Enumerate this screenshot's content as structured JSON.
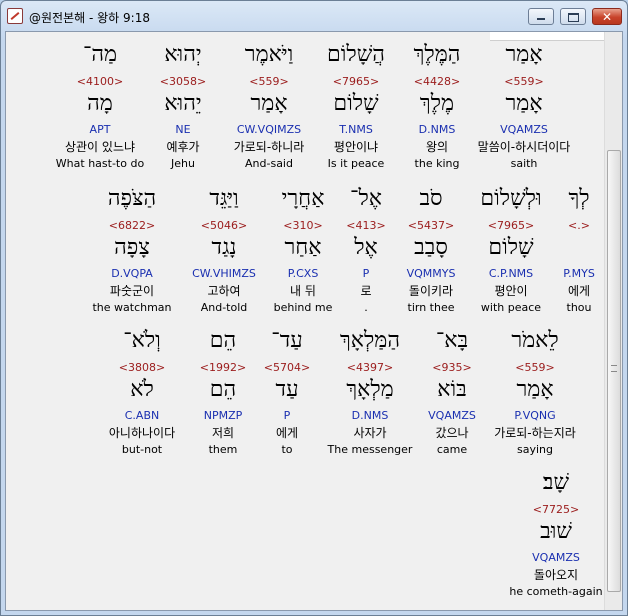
{
  "window": {
    "title": "@원전본해 - 왕하 9:18",
    "buttons": {
      "minimize": "minimize",
      "maximize": "maximize",
      "close": "✕"
    }
  },
  "rows": [
    {
      "words": [
        {
          "heb": "אָמַר",
          "strong": "<559>",
          "lemma": "אָמַר",
          "morph": "VQAMZS",
          "ko": "말씀이-하시더이다",
          "en": "saith"
        },
        {
          "heb": "הַמֶּלֶךְ",
          "strong": "<4428>",
          "lemma": "מֶלֶךְ",
          "morph": "D.NMS",
          "ko": "왕의",
          "en": "the king"
        },
        {
          "heb": "הֲשָׁלוֹם",
          "strong": "<7965>",
          "lemma": "שָׁלוֹם",
          "morph": "T.NMS",
          "ko": "평안이냐",
          "en": "Is it peace"
        },
        {
          "heb": "וַיֹּאמֶר",
          "strong": "<559>",
          "lemma": "אָמַר",
          "morph": "CW.VQIMZS",
          "ko": "가로되-하니라",
          "en": "And-said"
        },
        {
          "heb": "יְהוּא",
          "strong": "<3058>",
          "lemma": "יֵהוּא",
          "morph": "NE",
          "ko": "예후가",
          "en": "Jehu"
        },
        {
          "heb": "מַה־",
          "strong": "<4100>",
          "lemma": "מָה",
          "morph": "APT",
          "ko": "상관이 있느냐",
          "en": "What hast-to do"
        }
      ]
    },
    {
      "words": [
        {
          "heb": "לְךָ",
          "strong": "<.>",
          "lemma": "",
          "morph": "P.MYS",
          "ko": "에게",
          "en": "thou"
        },
        {
          "heb": "וּלְשָׁלוֹם",
          "strong": "<7965>",
          "lemma": "שָׁלוֹם",
          "morph": "C.P.NMS",
          "ko": "평안이",
          "en": "with peace"
        },
        {
          "heb": "סֹב",
          "strong": "<5437>",
          "lemma": "סָבַב",
          "morph": "VQMMYS",
          "ko": "돌이키라",
          "en": "tirn thee"
        },
        {
          "heb": "אֶל־",
          "strong": "<413>",
          "lemma": "אֶל",
          "morph": "P",
          "ko": "로",
          "en": "."
        },
        {
          "heb": "אַחֲרָי",
          "strong": "<310>",
          "lemma": "אַחַר",
          "morph": "P.CXS",
          "ko": "내 뒤",
          "en": "behind me"
        },
        {
          "heb": "וַיַּגֵּד",
          "strong": "<5046>",
          "lemma": "נָגַד",
          "morph": "CW.VHIMZS",
          "ko": "고하여",
          "en": "And-told"
        },
        {
          "heb": "הַצֹּפֶה",
          "strong": "<6822>",
          "lemma": "צָפָה",
          "morph": "D.VQPA",
          "ko": "파숫군이",
          "en": "the watchman"
        }
      ]
    },
    {
      "words": [
        {
          "heb": "לֵאמֹר",
          "strong": "<559>",
          "lemma": "אָמַר",
          "morph": "P.VQNG",
          "ko": "가로되-하는지라",
          "en": "saying"
        },
        {
          "heb": "בָּא־",
          "strong": "<935>",
          "lemma": "בּוֹא",
          "morph": "VQAMZS",
          "ko": "갔으나",
          "en": "came"
        },
        {
          "heb": "הַמַּלְאָךְ",
          "strong": "<4397>",
          "lemma": "מַלְאָךְ",
          "morph": "D.NMS",
          "ko": "사자가",
          "en": "The messenger"
        },
        {
          "heb": "עַד־",
          "strong": "<5704>",
          "lemma": "עַד",
          "morph": "P",
          "ko": "에게",
          "en": "to"
        },
        {
          "heb": "הֵם",
          "strong": "<1992>",
          "lemma": "הֵם",
          "morph": "NPMZP",
          "ko": "저희",
          "en": "them"
        },
        {
          "heb": "וְלֹא־",
          "strong": "<3808>",
          "lemma": "לֹא",
          "morph": "C.ABN",
          "ko": "아니하나이다",
          "en": "but-not"
        }
      ]
    },
    {
      "words": [
        {
          "heb": "שָׁב׃",
          "strong": "<7725>",
          "lemma": "שׁוּב",
          "morph": "VQAMZS",
          "ko": "돌아오지",
          "en": "he cometh-again"
        }
      ]
    }
  ]
}
